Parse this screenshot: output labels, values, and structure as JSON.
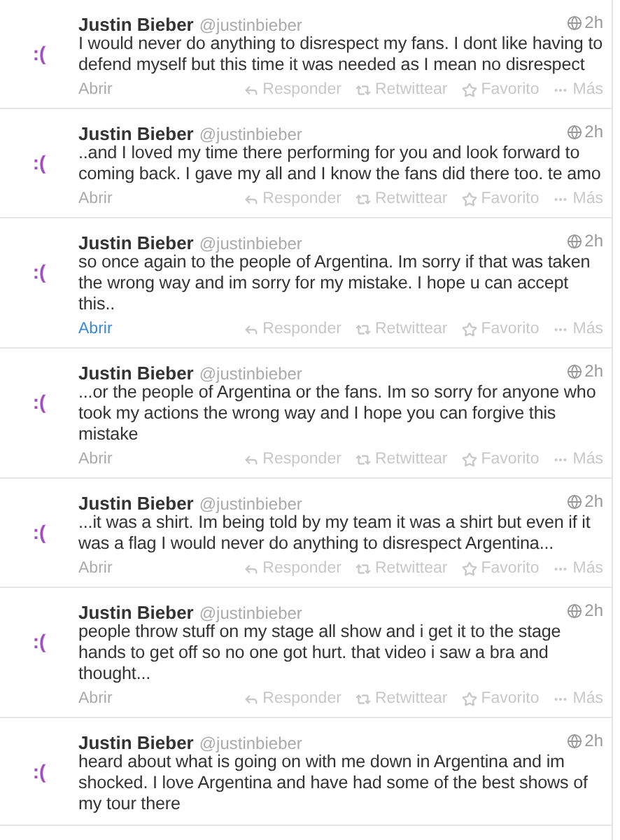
{
  "tweets": [
    {
      "avatar": ":(",
      "name": "Justin Bieber",
      "handle": "@justinbieber",
      "time": "2h",
      "text": "I would never do anything to disrespect my fans. I dont like having to defend myself but this time it was needed as I mean no disrespect",
      "open": {
        "label": "Abrir",
        "highlighted": false
      },
      "actions": [
        {
          "kind": "reply",
          "label": "Responder"
        },
        {
          "kind": "retweet",
          "label": "Retwittear"
        },
        {
          "kind": "favorite",
          "label": "Favorito"
        },
        {
          "kind": "more",
          "label": "Más"
        }
      ]
    },
    {
      "avatar": ":(",
      "name": "Justin Bieber",
      "handle": "@justinbieber",
      "time": "2h",
      "text": "..and I loved my time there performing for you and look forward to coming back. I gave my all and I know the fans did there too. te amo",
      "open": {
        "label": "Abrir",
        "highlighted": false
      },
      "actions": [
        {
          "kind": "reply",
          "label": "Responder"
        },
        {
          "kind": "retweet",
          "label": "Retwittear"
        },
        {
          "kind": "favorite",
          "label": "Favorito"
        },
        {
          "kind": "more",
          "label": "Más"
        }
      ]
    },
    {
      "avatar": ":(",
      "name": "Justin Bieber",
      "handle": "@justinbieber",
      "time": "2h",
      "text": "so once again to the people of Argentina. Im sorry if that was taken the wrong way and im sorry for my mistake. I hope u can accept this..",
      "open": {
        "label": "Abrir",
        "highlighted": true
      },
      "actions": [
        {
          "kind": "reply",
          "label": "Responder"
        },
        {
          "kind": "retweet",
          "label": "Retwittear"
        },
        {
          "kind": "favorite",
          "label": "Favorito"
        },
        {
          "kind": "more",
          "label": "Más"
        }
      ]
    },
    {
      "avatar": ":(",
      "name": "Justin Bieber",
      "handle": "@justinbieber",
      "time": "2h",
      "text": "...or the people of Argentina or the fans. Im so sorry for anyone who took my actions the wrong way and I hope you can forgive this mistake",
      "open": {
        "label": "Abrir",
        "highlighted": false
      },
      "actions": [
        {
          "kind": "reply",
          "label": "Responder"
        },
        {
          "kind": "retweet",
          "label": "Retwittear"
        },
        {
          "kind": "favorite",
          "label": "Favorito"
        },
        {
          "kind": "more",
          "label": "Más"
        }
      ]
    },
    {
      "avatar": ":(",
      "name": "Justin Bieber",
      "handle": "@justinbieber",
      "time": "2h",
      "text": "...it was a shirt. Im being told by my team it was a shirt but even if it was a flag I would never do anything to disrespect Argentina...",
      "open": {
        "label": "Abrir",
        "highlighted": false
      },
      "actions": [
        {
          "kind": "reply",
          "label": "Responder"
        },
        {
          "kind": "retweet",
          "label": "Retwittear"
        },
        {
          "kind": "favorite",
          "label": "Favorito"
        },
        {
          "kind": "more",
          "label": "Más"
        }
      ]
    },
    {
      "avatar": ":(",
      "name": "Justin Bieber",
      "handle": "@justinbieber",
      "time": "2h",
      "text": "people throw stuff on my stage all show and i get it to the stage hands to get off so no one got hurt. that video i saw a bra and thought...",
      "open": {
        "label": "Abrir",
        "highlighted": false
      },
      "actions": [
        {
          "kind": "reply",
          "label": "Responder"
        },
        {
          "kind": "retweet",
          "label": "Retwittear"
        },
        {
          "kind": "favorite",
          "label": "Favorito"
        },
        {
          "kind": "more",
          "label": "Más"
        }
      ]
    },
    {
      "avatar": ":(",
      "name": "Justin Bieber",
      "handle": "@justinbieber",
      "time": "2h",
      "text": "heard about what is going on with me down in Argentina and im shocked. I love Argentina and have had some of the best shows of my tour there"
    }
  ]
}
